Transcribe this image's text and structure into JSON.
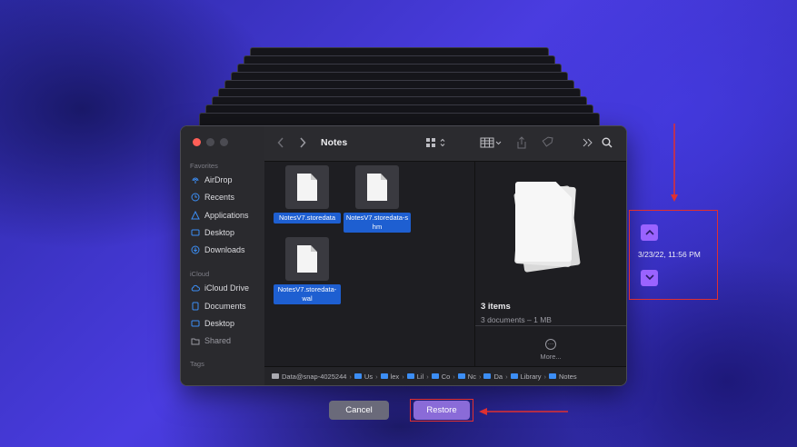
{
  "finder": {
    "title": "Notes",
    "sidebar": {
      "favorites_label": "Favorites",
      "favorites": [
        {
          "label": "AirDrop",
          "icon": "airdrop-icon"
        },
        {
          "label": "Recents",
          "icon": "clock-icon"
        },
        {
          "label": "Applications",
          "icon": "applications-icon"
        },
        {
          "label": "Desktop",
          "icon": "desktop-icon"
        },
        {
          "label": "Downloads",
          "icon": "download-icon"
        }
      ],
      "icloud_label": "iCloud",
      "icloud": [
        {
          "label": "iCloud Drive",
          "icon": "cloud-icon"
        },
        {
          "label": "Documents",
          "icon": "document-icon"
        },
        {
          "label": "Desktop",
          "icon": "desktop-icon"
        },
        {
          "label": "Shared",
          "icon": "shared-folder-icon"
        }
      ],
      "tags_label": "Tags"
    },
    "files": [
      {
        "name": "NotesV7.storedata"
      },
      {
        "name": "NotesV7.storedata-shm"
      },
      {
        "name": "NotesV7.storedata-wal"
      }
    ],
    "preview": {
      "count": "3 items",
      "detail": "3 documents – 1 MB",
      "more": "More..."
    },
    "path": [
      "Data@snap-4025244",
      "Us",
      "lex",
      "Lil",
      "Co",
      "Nc",
      "Da",
      "Library",
      "Notes"
    ]
  },
  "time_machine": {
    "timestamp": "3/23/22, 11:56 PM"
  },
  "buttons": {
    "cancel": "Cancel",
    "restore": "Restore"
  },
  "colors": {
    "accent": "#9a63ff",
    "highlight": "#e03030",
    "selection": "#1e5fd1"
  }
}
